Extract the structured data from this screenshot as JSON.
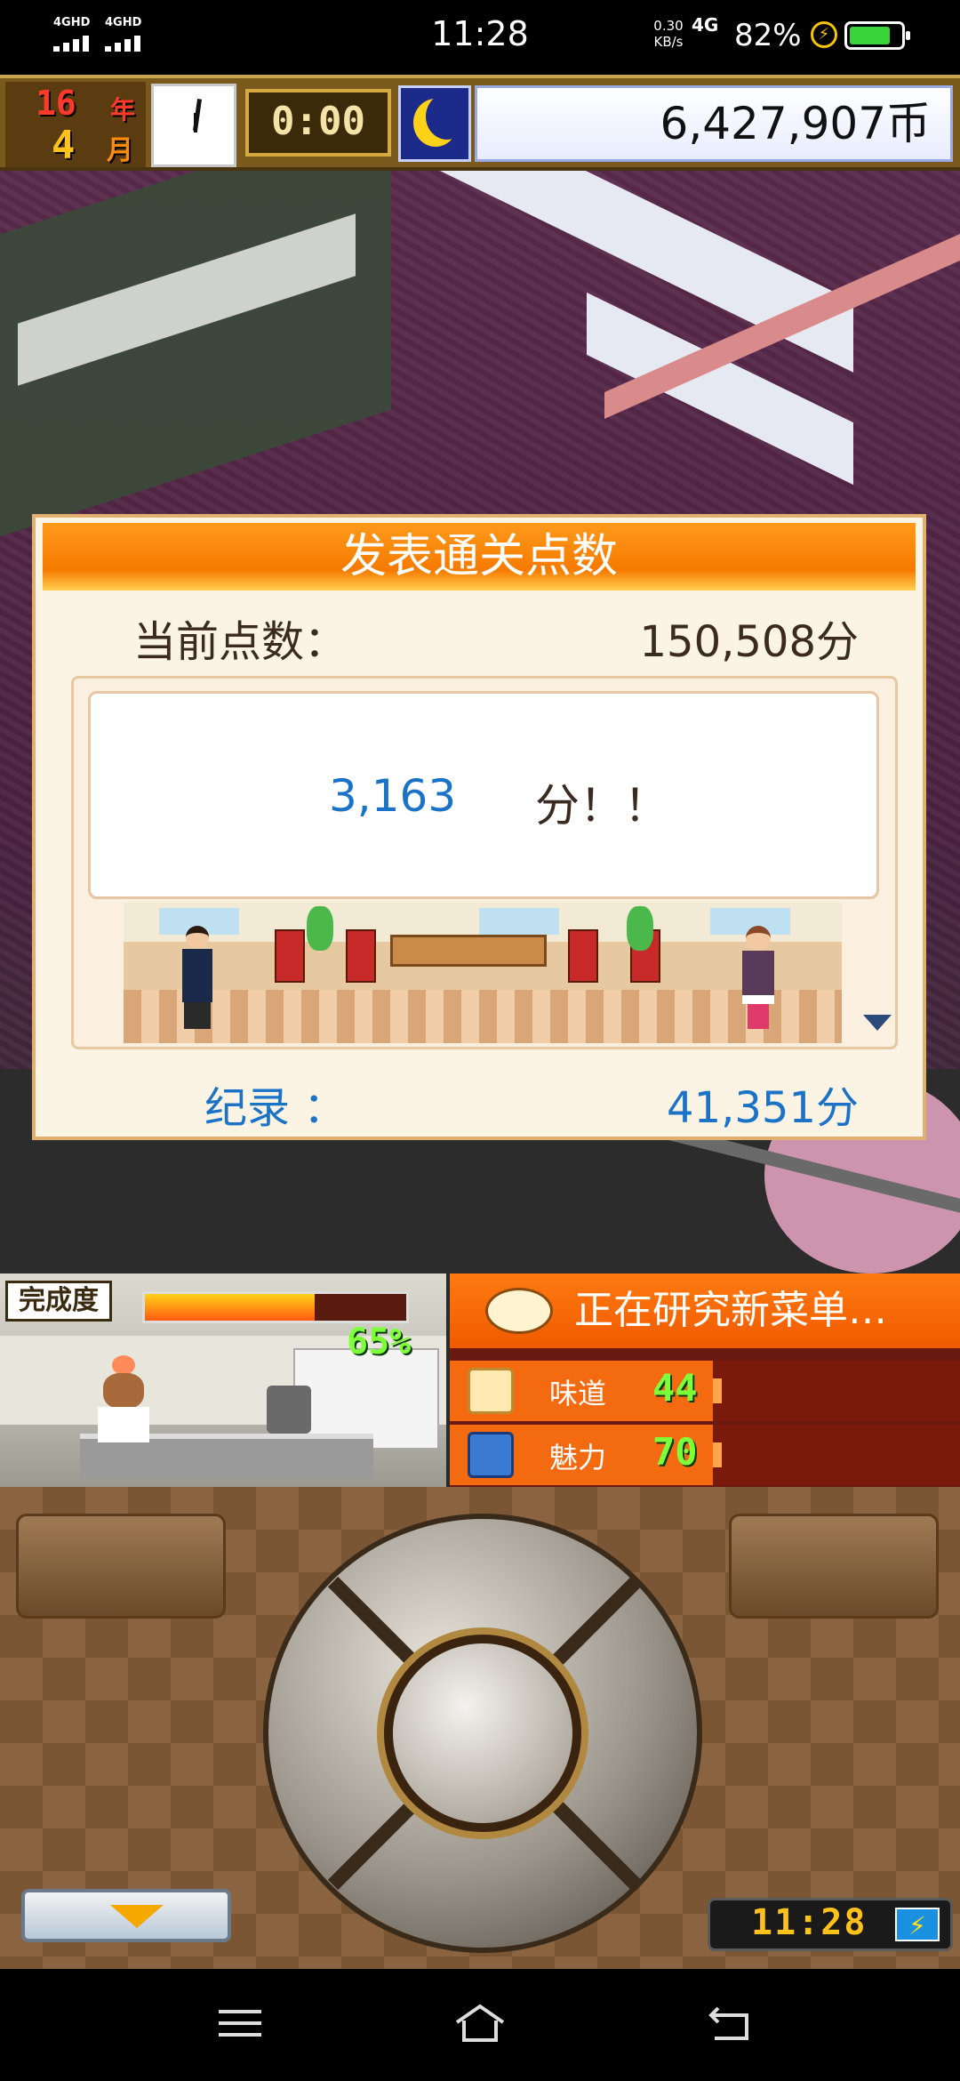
{
  "status_bar": {
    "signal1_label": "4GHD",
    "signal2_label": "4GHD",
    "time": "11:28",
    "net_speed_value": "0.30",
    "net_speed_unit": "KB/s",
    "net_type": "4G",
    "battery_percent": "82%",
    "battery_level": 0.82,
    "battery_color": "#3ad33a"
  },
  "hud": {
    "year": "16",
    "year_unit": "年",
    "month": "4",
    "month_unit": "月",
    "time": "0:00",
    "money": "6,427,907币"
  },
  "dialog": {
    "title": "发表通关点数",
    "current_label": "当前点数：",
    "current_value": "150,508分",
    "message_number": "3,163",
    "message_suffix": "分！！",
    "record_label": "纪录 ：",
    "record_value": "41,351分",
    "accent_color": "#1a73c7",
    "header_color": "#f57a00"
  },
  "progress": {
    "label": "完成度",
    "percent_text": "65%",
    "percent_value": 0.65
  },
  "research": {
    "title": "正在研究新菜单…",
    "stats": [
      {
        "name": "味道",
        "value": "44",
        "icon": "taste-icon"
      },
      {
        "name": "魅力",
        "value": "70",
        "icon": "charm-icon"
      }
    ]
  },
  "controller": {
    "game_clock": "11:28"
  }
}
